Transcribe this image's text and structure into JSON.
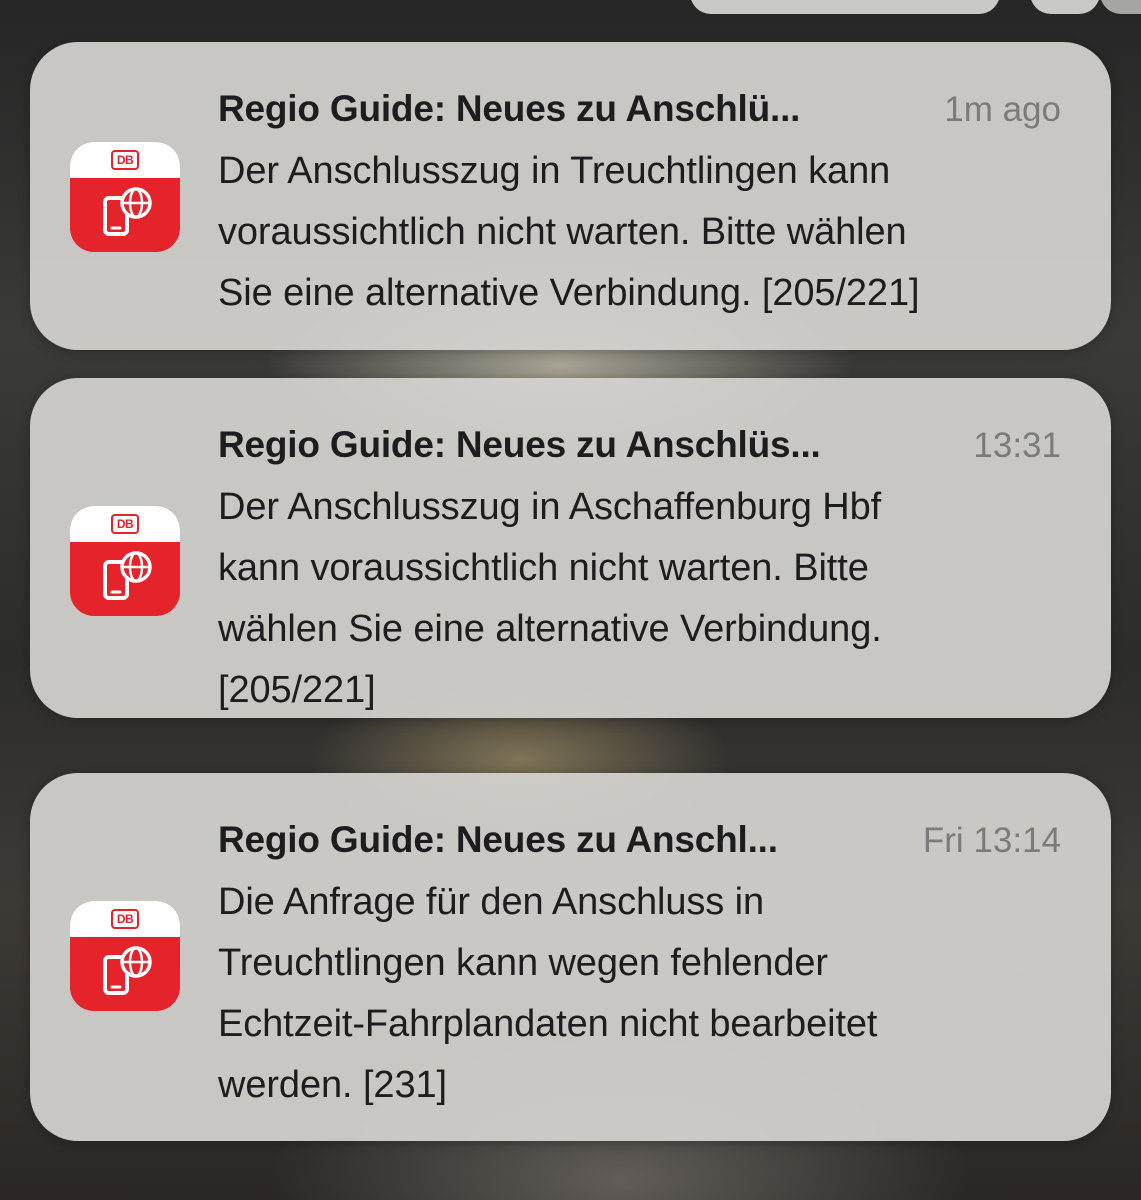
{
  "notifications": [
    {
      "app_icon": "db-regio-guide-icon",
      "logo_text": "DB",
      "title": "Regio Guide: Neues zu Anschlü...",
      "time": "1m ago",
      "body_lines": [
        "Der Anschlusszug in Treuchtlingen kann",
        "voraussichtlich nicht warten. Bitte wählen",
        "Sie eine alternative Verbindung. [205/221]"
      ]
    },
    {
      "app_icon": "db-regio-guide-icon",
      "logo_text": "DB",
      "title": "Regio Guide: Neues zu Anschlüs...",
      "time": "13:31",
      "body_lines": [
        "Der Anschlusszug in Aschaffenburg Hbf",
        "kann voraussichtlich nicht warten. Bitte",
        "wählen Sie eine alternative Verbindung.",
        "[205/221]"
      ]
    },
    {
      "app_icon": "db-regio-guide-icon",
      "logo_text": "DB",
      "title": "Regio Guide: Neues zu Anschl...",
      "time": "Fri 13:14",
      "body_lines": [
        "Die Anfrage für den Anschluss in",
        "Treuchtlingen kann wegen fehlender",
        "Echtzeit-Fahrplandaten nicht bearbeitet",
        "werden. [231]"
      ]
    }
  ],
  "colors": {
    "db_red": "#e4232b",
    "card_background": "#d4d3d0",
    "title_text": "#1d1d1f",
    "time_text": "#7b7b7b"
  }
}
